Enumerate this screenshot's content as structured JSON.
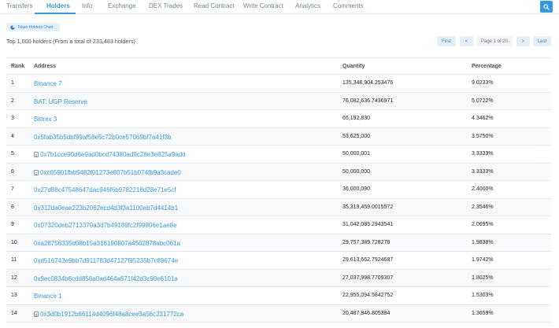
{
  "tabs": [
    {
      "label": "Transfers",
      "active": false
    },
    {
      "label": "Holders",
      "active": true
    },
    {
      "label": "Info",
      "active": false
    },
    {
      "label": "Exchange",
      "active": false
    },
    {
      "label": "DEX Trades",
      "active": false
    },
    {
      "label": "Read Contract",
      "active": false
    },
    {
      "label": "Write Contract",
      "active": false
    },
    {
      "label": "Analytics",
      "active": false
    },
    {
      "label": "Comments",
      "active": false
    }
  ],
  "search_icon": "search-icon",
  "chart_button": {
    "label": "Token Holders Chart",
    "icon": "pie-chart-icon"
  },
  "summary": "Top 1,000 holders (From a total of 233,483 holders)",
  "pagination": {
    "first": "First",
    "prev": "<",
    "page_info": "Page 1 of 20",
    "next": ">",
    "last": "Last"
  },
  "table": {
    "headers": {
      "rank": "Rank",
      "address": "Address",
      "quantity": "Quantity",
      "percentage": "Percentage"
    },
    "rows": [
      {
        "rank": "1",
        "address": "Binance 7",
        "quantity": "135,348,904.253476",
        "percentage": "9.0233%",
        "contract": false
      },
      {
        "rank": "2",
        "address": "BAT: UGP Reserve",
        "quantity": "76,082,636.7436971",
        "percentage": "5.0722%",
        "contract": false
      },
      {
        "rank": "3",
        "address": "Bittrex 3",
        "quantity": "65,192,830",
        "percentage": "4.3462%",
        "contract": false
      },
      {
        "rank": "4",
        "address": "0x5fab35b5dbf99af58e5c72b0ce57069bf7a41f3b",
        "quantity": "53,625,000",
        "percentage": "3.5750%",
        "contract": false
      },
      {
        "rank": "5",
        "address": "0x7b1cce90d6e9ad0bcd74380ad9c28e3e825a9add",
        "quantity": "50,000,001",
        "percentage": "3.3333%",
        "contract": true
      },
      {
        "rank": "6",
        "address": "0xc65901fbb5482f01273e607b51b074fb9a3cade0",
        "quantity": "50,000,000",
        "percentage": "3.3333%",
        "contract": true
      },
      {
        "rank": "7",
        "address": "0x27d88c47548647dac946f6b9782218d28e71e5cf",
        "quantity": "36,000,090",
        "percentage": "2.4000%",
        "contract": false
      },
      {
        "rank": "8",
        "address": "0x312da0eae223b2062ecd4d3f3a1100eb7d4414b1",
        "quantity": "35,319,459.0015572",
        "percentage": "2.3546%",
        "contract": false
      },
      {
        "rank": "9",
        "address": "0x07320deb2713370a3d7b49189fc2f99906e1ae8e",
        "quantity": "31,042,085.2943541",
        "percentage": "2.0695%",
        "contract": false
      },
      {
        "rank": "10",
        "address": "0xa28756335d08b15a316190807a4502878abc061a",
        "quantity": "29,757,389.728278",
        "percentage": "1.9838%",
        "contract": false
      },
      {
        "rank": "11",
        "address": "0xd516743e9bb7d911783d47127f95235b7c69674e",
        "quantity": "29,613,662.7924687",
        "percentage": "1.9742%",
        "contract": false
      },
      {
        "rank": "12",
        "address": "0x9ec0834b6cdd856a0ad464a671f42d3c90e6101a",
        "quantity": "27,037,998.7709307",
        "percentage": "1.8025%",
        "contract": false
      },
      {
        "rank": "13",
        "address": "Binance 1",
        "quantity": "22,955,094.5842752",
        "percentage": "1.5303%",
        "contract": false
      },
      {
        "rank": "14",
        "address": "0x3d0b1912b66114d4096f48a8cee3a56c231772ca",
        "quantity": "20,487,846.805384",
        "percentage": "1.3659%",
        "contract": true
      }
    ]
  },
  "colors": {
    "accent": "#3498db",
    "border": "#e7eaf3",
    "text": "#1e2022",
    "muted": "#77838f"
  }
}
